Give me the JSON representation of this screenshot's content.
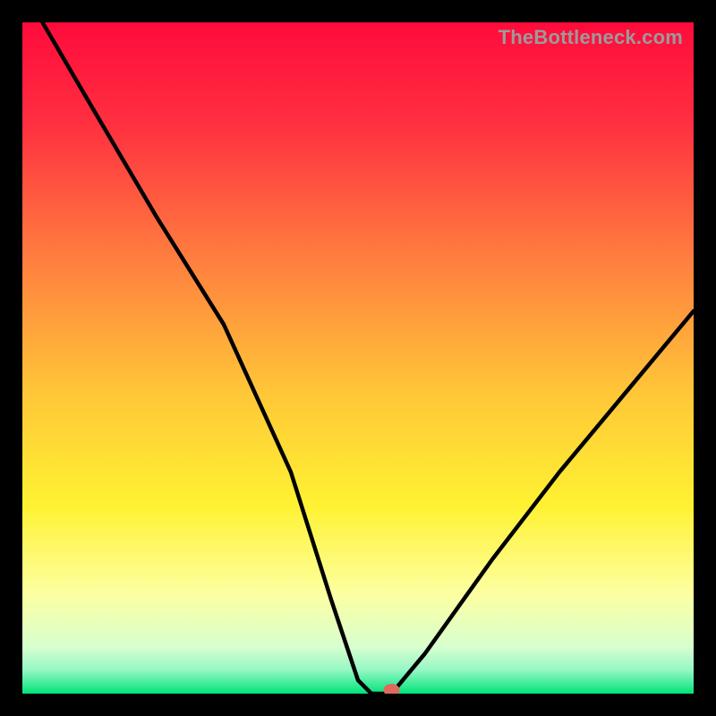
{
  "watermark": "TheBottleneck.com",
  "domain": "Chart",
  "chart_data": {
    "type": "line",
    "title": "",
    "xlabel": "",
    "ylabel": "",
    "xlim": [
      0,
      100
    ],
    "ylim": [
      0,
      100
    ],
    "x": [
      3,
      10,
      20,
      30,
      40,
      46,
      50,
      52,
      55,
      60,
      70,
      80,
      90,
      100
    ],
    "values": [
      100,
      88,
      71,
      55,
      33,
      14,
      2,
      0,
      0,
      6,
      20,
      33,
      45,
      57
    ],
    "marker": {
      "x": 55,
      "y": 0
    },
    "gradient_stops": [
      {
        "offset": 0.0,
        "color": "#ff0b3c"
      },
      {
        "offset": 0.15,
        "color": "#ff2f40"
      },
      {
        "offset": 0.35,
        "color": "#ff7d3f"
      },
      {
        "offset": 0.55,
        "color": "#ffc638"
      },
      {
        "offset": 0.72,
        "color": "#fff232"
      },
      {
        "offset": 0.85,
        "color": "#fdffa0"
      },
      {
        "offset": 0.93,
        "color": "#d8ffcf"
      },
      {
        "offset": 0.965,
        "color": "#94f7c4"
      },
      {
        "offset": 1.0,
        "color": "#00e37a"
      }
    ],
    "note": "Curve values read approximately from the image; y is a percentage-like score that dips to 0 near x≈52–55 and rises on either side."
  }
}
